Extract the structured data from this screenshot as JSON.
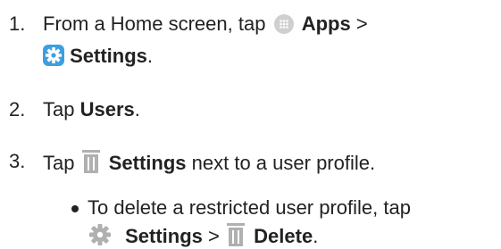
{
  "steps": [
    {
      "number": "1.",
      "part1": "From a Home screen, tap",
      "apps_label": "Apps",
      "sep": ">",
      "settings_label": "Settings",
      "end": "."
    },
    {
      "number": "2.",
      "prefix": "Tap",
      "bold": "Users",
      "end": "."
    },
    {
      "number": "3.",
      "prefix": "Tap",
      "bold": "Settings",
      "suffix": "next to a user profile."
    }
  ],
  "sub_bullet": {
    "text": "To delete a restricted user profile, tap",
    "settings_label": "Settings",
    "sep": ">",
    "delete_label": "Delete",
    "end": "."
  },
  "icons": {
    "apps": "apps-icon",
    "settings": "settings-icon",
    "trash": "trash-icon",
    "gear": "gear-icon"
  },
  "colors": {
    "text": "#222222",
    "settings_blue": "#3d9fe0",
    "icon_grey": "#b0b0b0",
    "apps_bg": "#cfcfcf"
  }
}
